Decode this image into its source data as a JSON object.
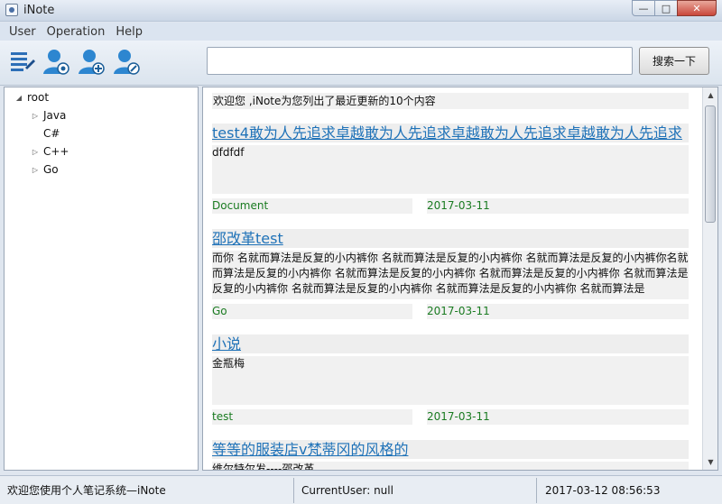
{
  "window": {
    "title": "iNote"
  },
  "menu": [
    "User",
    "Operation",
    "Help"
  ],
  "toolbar": {
    "icons": [
      "notes-list-icon",
      "user-view-icon",
      "user-add-icon",
      "user-edit-icon"
    ],
    "search_value": "",
    "search_button": "搜索一下"
  },
  "tree": {
    "root": "root",
    "items": [
      {
        "label": "Java",
        "expandable": true
      },
      {
        "label": "C#",
        "expandable": false
      },
      {
        "label": "C++",
        "expandable": true
      },
      {
        "label": "Go",
        "expandable": true
      }
    ]
  },
  "content": {
    "welcome": "欢迎您 ,iNote为您列出了最近更新的10个内容",
    "items": [
      {
        "title": "test4敢为人先追求卓越敢为人先追求卓越敢为人先追求卓越敢为人先追求",
        "body": "dfdfdf",
        "tag": "Document",
        "date": "2017-03-11"
      },
      {
        "title": "邵改革test",
        "body": "而你 名就而算法是反复的小内裤你 名就而算法是反复的小内裤你 名就而算法是反复的小内裤你名就而算法是反复的小内裤你 名就而算法是反复的小内裤你 名就而算法是反复的小内裤你 名就而算法是反复的小内裤你 名就而算法是反复的小内裤你 名就而算法是反复的小内裤你 名就而算法是",
        "tag": "Go",
        "date": "2017-03-11"
      },
      {
        "title": "小说",
        "body": "金瓶梅",
        "tag": "test",
        "date": "2017-03-11"
      },
      {
        "title": "等等的服装店v梵蒂冈的风格的",
        "body": "维尔特尔发----邵改革",
        "tag": "",
        "date": ""
      }
    ]
  },
  "status": {
    "message": "欢迎您使用个人笔记系统—iNote",
    "current_user": "CurrentUser: null",
    "datetime": "2017-03-12 08:56:53"
  },
  "colors": {
    "link": "#1f72b8",
    "tag": "#1a7b21",
    "window_chrome": "#dbe4f0"
  }
}
